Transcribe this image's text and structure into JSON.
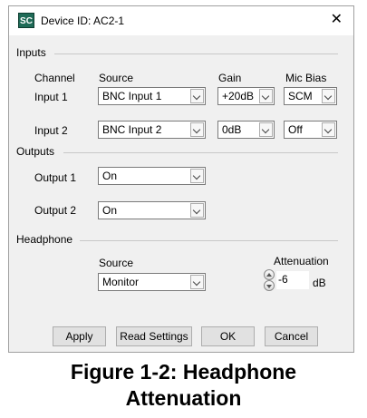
{
  "window": {
    "title": "Device ID: AC2-1",
    "icon_text": "SC",
    "close_symbol": "✕"
  },
  "inputs": {
    "section_label": "Inputs",
    "headers": {
      "channel": "Channel",
      "source": "Source",
      "gain": "Gain",
      "mic_bias": "Mic Bias"
    },
    "rows": [
      {
        "channel": "Input 1",
        "source": "BNC Input 1",
        "gain": "+20dB",
        "mic_bias": "SCM"
      },
      {
        "channel": "Input 2",
        "source": "BNC Input 2",
        "gain": "0dB",
        "mic_bias": "Off"
      }
    ]
  },
  "outputs": {
    "section_label": "Outputs",
    "rows": [
      {
        "label": "Output 1",
        "value": "On"
      },
      {
        "label": "Output 2",
        "value": "On"
      }
    ]
  },
  "headphone": {
    "section_label": "Headphone",
    "source_label": "Source",
    "source_value": "Monitor",
    "attenuation_label": "Attenuation",
    "attenuation_value": "-6",
    "attenuation_unit": "dB"
  },
  "buttons": {
    "apply": "Apply",
    "read_settings": "Read Settings",
    "ok": "OK",
    "cancel": "Cancel"
  },
  "caption": {
    "line1": "Figure  1-2:  Headphone",
    "line2": "Attenuation"
  }
}
